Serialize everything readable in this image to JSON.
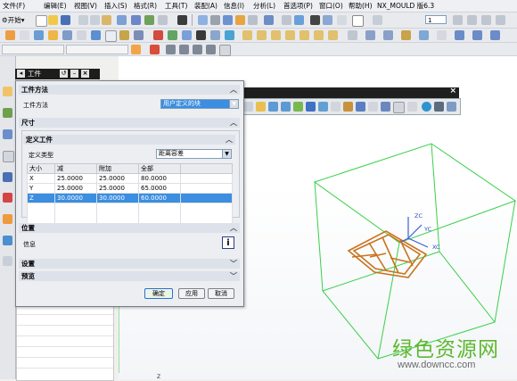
{
  "menu": [
    "文件(F)",
    "编辑(E)",
    "视图(V)",
    "插入(S)",
    "格式(R)",
    "工具(T)",
    "装配(A)",
    "信息(I)",
    "分析(L)",
    "首选项(P)",
    "窗口(O)",
    "帮助(H)"
  ],
  "app_title": "NX_MOULD 版6.3",
  "start_button": "开始",
  "toolbar_dropdown_value": "1",
  "dialog": {
    "tab_label": "工件",
    "sections": {
      "work_method_header": "工件方法",
      "work_method_label": "工件方法",
      "work_method_value": "用户定义的块",
      "size_header": "尺寸",
      "define_work_header": "定义工件",
      "define_type_label": "定义类型",
      "define_type_value": "距离容差",
      "position_header": "位置",
      "info_label": "信息",
      "settings_header": "设置",
      "preview_header": "预览"
    },
    "table": {
      "headers": [
        "大小",
        "减",
        "附加",
        "全部"
      ],
      "rows": [
        {
          "axis": "X",
          "minus": "25.0000",
          "plus": "25.0000",
          "total": "80.0000"
        },
        {
          "axis": "Y",
          "minus": "25.0000",
          "plus": "25.0000",
          "total": "65.0000"
        },
        {
          "axis": "Z",
          "minus": "30.0000",
          "plus": "30.0000",
          "total": "60.0000"
        }
      ]
    },
    "buttons": {
      "ok": "确定",
      "apply": "应用",
      "cancel": "取消"
    }
  },
  "csys": {
    "zc": "ZC",
    "yc": "YC",
    "xc": "XC",
    "z": "Z"
  },
  "watermark": {
    "title": "绿色资源网",
    "url": "www.downcc.com"
  },
  "colors": {
    "wireframe": "#39d04a",
    "part": "#c8741e",
    "selection": "#3b8ee0",
    "watermark": "#5db82f"
  }
}
